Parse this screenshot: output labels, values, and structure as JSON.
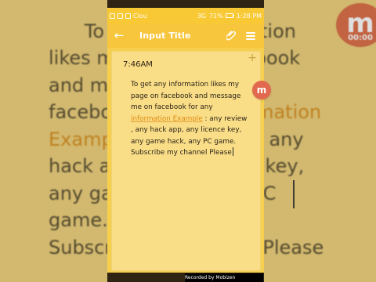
{
  "app": {
    "title": "Input Title"
  },
  "status_bar": {
    "left_text": "Clou",
    "network_text": "3G",
    "battery_text": "71%",
    "time": "1:28 PM"
  },
  "note": {
    "timestamp": "7:46AM",
    "text_before_link": "To get any information likes my page on facebook and message me on facebook for any ",
    "link_text": "information Example",
    "text_after_link": " : any review , any hack app,  any licence key, any game hack,  any PC game.",
    "last_line": "Subscribe my channel Please"
  },
  "badge": {
    "letter": "m",
    "time": "00:00"
  },
  "watermark": {
    "text": "Recorded by Mobizen"
  },
  "colors": {
    "appbar": "#f7c63d",
    "statusbar": "#f9c935",
    "note_background": "#f9dd87",
    "note_border": "#f7cf4e",
    "link": "#e08d12",
    "badge": "#e2694f"
  },
  "icons": {
    "back": "arrow-left-icon",
    "attachment": "paperclip-icon",
    "menu": "hamburger-menu-icon",
    "add": "plus-icon"
  }
}
